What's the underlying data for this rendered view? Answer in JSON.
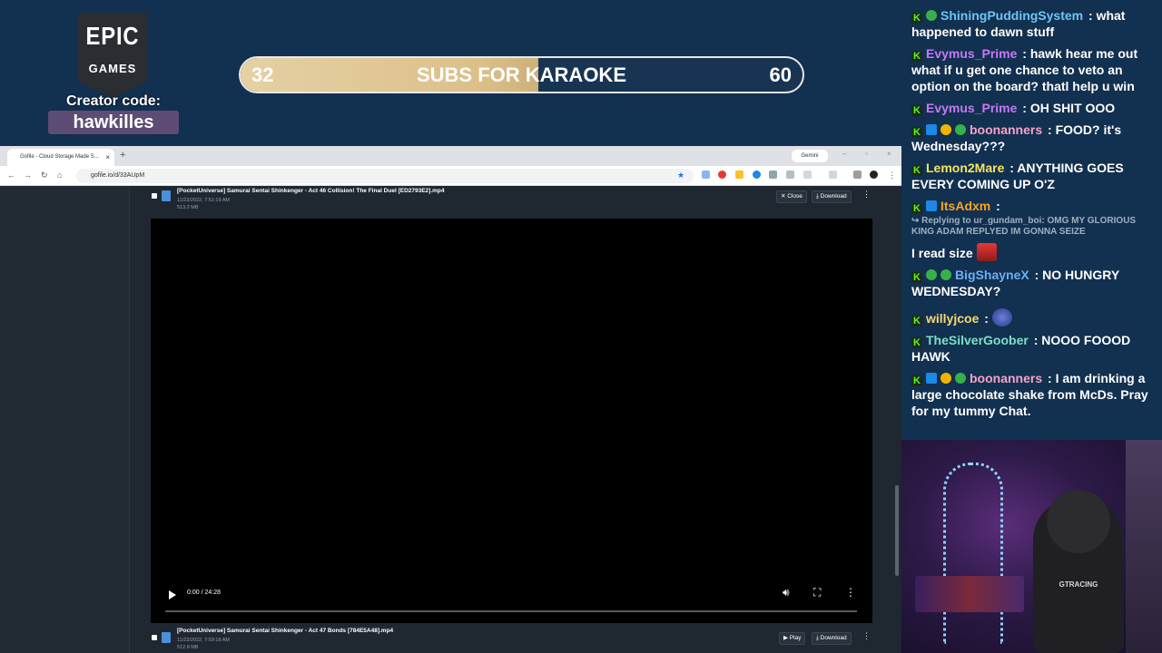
{
  "overlay": {
    "epic_text_1": "EPIC",
    "epic_text_2": "GAMES",
    "creator_label": "Creator code:",
    "creator_code": "hawkilles",
    "subgoal": {
      "current": "32",
      "target": "60",
      "title": "SUBS FOR KARAOKE",
      "progress_fraction": 0.53
    }
  },
  "browser": {
    "tab_title": "Gofile - Cloud Storage Made S...",
    "tab_close": "×",
    "new_tab": "+",
    "gemini_label": "Gemini",
    "url": "gofile.io/d/33AUpM",
    "window_controls": [
      "–",
      "▫",
      "×"
    ]
  },
  "gofile": {
    "files": [
      {
        "name": "[PocketUniverse] Samurai Sentai Shinkenger - Act 46 Collision! The Final Duel [ED2793E2].mp4",
        "date": "11/23/2022, 7:51:19 AM",
        "size": "513.2 MB",
        "btn1": "✕ Close",
        "btn2": "⤓ Download"
      },
      {
        "name": "[PocketUniverse] Samurai Sentai Shinkenger - Act 47 Bonds [784E5A48].mp4",
        "date": "11/23/2022, 7:59:18 AM",
        "size": "512.8 MB",
        "btn1": "▶ Play",
        "btn2": "⤓ Download"
      }
    ],
    "video_time": "0:00 / 24:28"
  },
  "chat": {
    "messages": [
      {
        "user": "ShiningPuddingSystem",
        "color": "#6ec6f7",
        "text": " : what happened to dawn stuff"
      },
      {
        "user": "Evymus_Prime",
        "color": "#c679f5",
        "text": " : hawk hear me out what if u get one chance to veto an option on the board? thatl help u win"
      },
      {
        "user": "Evymus_Prime",
        "color": "#c679f5",
        "text": " : OH SHIT OOO"
      },
      {
        "user": "boonanners",
        "color": "#f5a3c7",
        "text": " : FOOD? it's Wednesday???"
      },
      {
        "user": "Lemon2Mare",
        "color": "#f5e663",
        "text": " : ANYTHING GOES EVERY COMING UP O'Z"
      },
      {
        "user": "ItsAdxm",
        "color": "#f5a623",
        "text": " :"
      },
      {
        "user": "BigShayneX",
        "color": "#6ab0f5",
        "text": " : NO HUNGRY WEDNESDAY?"
      },
      {
        "user": "willyjcoe",
        "color": "#f5d76e",
        "text": " :"
      },
      {
        "user": "TheSilverGoober",
        "color": "#7ee0c8",
        "text": " : NOOO FOOOD HAWK"
      },
      {
        "user": "boonanners",
        "color": "#f5a3c7",
        "text": " : I am drinking a large chocolate shake from McDs. Pray for my tummy Chat."
      }
    ],
    "reply_text": "↪ Replying to ur_gundam_boi: OMG MY GLORIOUS KING ADAM REPLYED IM GONNA SEIZE",
    "standalone_text": "I read size",
    "badge_k": "K"
  },
  "webcam": {
    "chair_brand": "GTRACING"
  }
}
